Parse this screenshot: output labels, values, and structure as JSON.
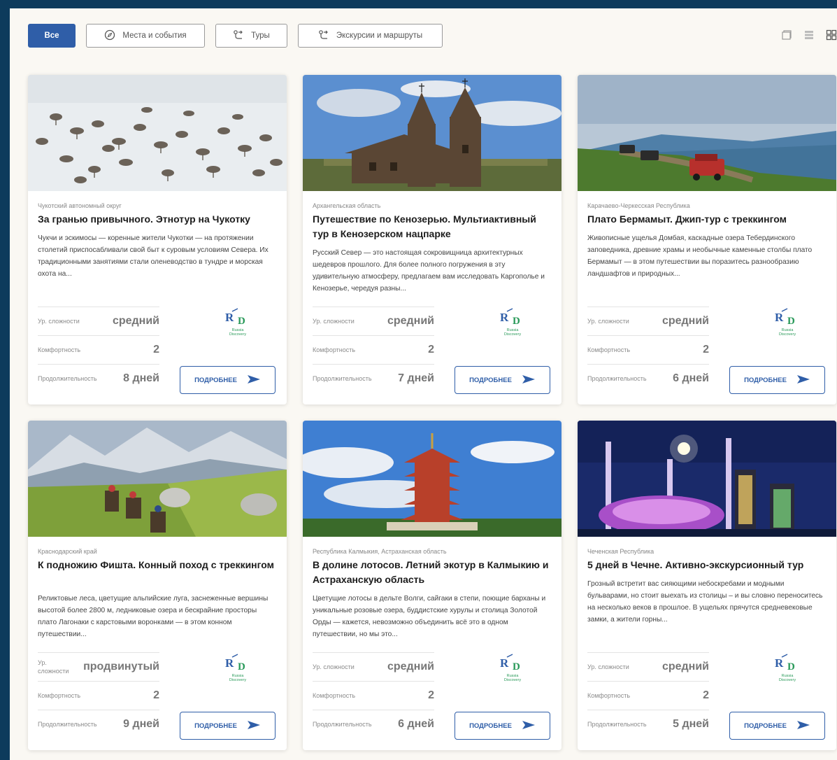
{
  "filters": {
    "all": "Все",
    "places": "Места и события",
    "tours": "Туры",
    "excursions": "Экскурсии и маршруты"
  },
  "labels": {
    "difficulty": "Ур. сложности",
    "comfort": "Комфортность",
    "duration": "Продолжительность",
    "more": "ПОДРОБНЕЕ",
    "logo_text": "Russia Discovery"
  },
  "colors": {
    "accent": "#2f5ea8",
    "frame": "#0d3b5c",
    "panel": "#faf8f3"
  },
  "cards": [
    {
      "region": "Чукотский автономный округ",
      "title": "За гранью привычного. Этнотур на Чукотку",
      "description": "Чукчи и эскимосы — коренные жители Чукотки — на протяжении столетий приспосабливали свой быт к суровым условиям Севера. Их традиционными занятиями стали оленеводство в тундре и морская охота на...",
      "difficulty": "средний",
      "comfort": "2",
      "duration": "8 дней"
    },
    {
      "region": "Архангельская область",
      "title": "Путешествие по Кенозерью. Мультиактивный тур в Кенозерском нацпарке",
      "description": "Русский Север — это настоящая сокровищница архитектурных шедевров прошлого. Для более полного погружения в эту удивительную атмосферу, предлагаем вам исследовать Каргополье и Кенозерье, чередуя разны...",
      "difficulty": "средний",
      "comfort": "2",
      "duration": "7 дней"
    },
    {
      "region": "Карачаево-Черкесская Республика",
      "title": "Плато Бермамыт. Джип-тур с треккингом",
      "description": "Живописные ущелья Домбая, каскадные озера Тебердинского заповедника, древние храмы и необычные каменные столбы плато Бермамыт — в этом путешествии вы поразитесь разнообразию ландшафтов и природных...",
      "difficulty": "средний",
      "comfort": "2",
      "duration": "6 дней"
    },
    {
      "region": "Краснодарский край",
      "title": "К подножию Фишта. Конный поход с треккингом",
      "description": "Реликтовые леса, цветущие альпийские луга, заснеженные вершины высотой более 2800 м, ледниковые озера и бескрайние просторы плато Лагонаки с карстовыми воронками — в этом конном путешествии...",
      "difficulty": "продвинутый",
      "comfort": "2",
      "duration": "9 дней"
    },
    {
      "region": "Республика Калмыкия, Астраханская область",
      "title": "В долине лотосов. Летний экотур в Калмыкию и Астраханскую область",
      "description": "Цветущие лотосы в дельте Волги, сайгаки в степи, поющие барханы и уникальные розовые озера, буддистские хурулы и столица Золотой Орды — кажется, невозможно объединить всё это в одном путешествии, но мы это...",
      "difficulty": "средний",
      "comfort": "2",
      "duration": "6 дней"
    },
    {
      "region": "Чеченская Республика",
      "title": "5 дней в Чечне. Активно-экскурсионный тур",
      "description": "Грозный встретит вас сияющими небоскребами и модными бульварами, но стоит выехать из столицы – и вы словно переноситесь на несколько веков в прошлое. В ущельях прячутся средневековые замки, а жители горны...",
      "difficulty": "средний",
      "comfort": "2",
      "duration": "5 дней"
    }
  ]
}
